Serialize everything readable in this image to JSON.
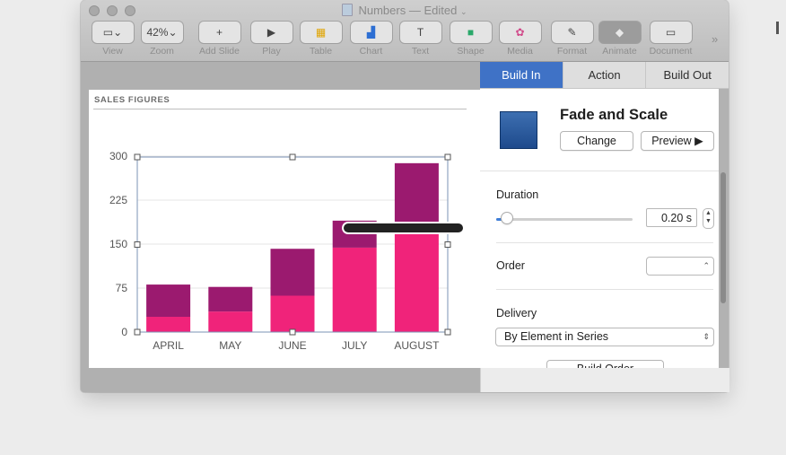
{
  "window": {
    "title": "Numbers",
    "status": "— Edited"
  },
  "toolbar": [
    {
      "label": "View",
      "icon": "sidebar-icon",
      "glyph": "▭⌄"
    },
    {
      "label": "Zoom",
      "icon": "zoom-icon",
      "glyph": "42%⌄"
    },
    {
      "label": "Add Slide",
      "icon": "plus-icon",
      "glyph": "+"
    },
    {
      "label": "Play",
      "icon": "play-icon",
      "glyph": "▶"
    },
    {
      "label": "Table",
      "icon": "table-icon",
      "glyph": "▦"
    },
    {
      "label": "Chart",
      "icon": "chart-icon",
      "glyph": "▟"
    },
    {
      "label": "Text",
      "icon": "text-icon",
      "glyph": "T"
    },
    {
      "label": "Shape",
      "icon": "shape-icon",
      "glyph": "■"
    },
    {
      "label": "Media",
      "icon": "media-icon",
      "glyph": "✿"
    },
    {
      "label": "Format",
      "icon": "format-icon",
      "glyph": "✎"
    },
    {
      "label": "Animate",
      "icon": "animate-icon",
      "glyph": "◆"
    },
    {
      "label": "Document",
      "icon": "document-icon",
      "glyph": "▭"
    }
  ],
  "toolbar_more": "»",
  "slide": {
    "chart_title": "SALES FIGURES"
  },
  "chart_data": {
    "type": "bar",
    "stacked": true,
    "title": "SALES FIGURES",
    "categories": [
      "APRIL",
      "MAY",
      "JUNE",
      "JULY",
      "AUGUST"
    ],
    "series": [
      {
        "values": [
          26,
          35,
          62,
          144,
          168
        ],
        "color": "#f0237a"
      },
      {
        "values": [
          55,
          42,
          80,
          46,
          120
        ],
        "color": "#9b1a6f"
      }
    ],
    "ylim": [
      0,
      300
    ],
    "yticks": [
      "0",
      "75",
      "150",
      "225",
      "300"
    ],
    "grid": true
  },
  "inspector": {
    "tabs": [
      {
        "label": "Build In",
        "selected": true
      },
      {
        "label": "Action",
        "selected": false
      },
      {
        "label": "Build Out",
        "selected": false
      }
    ],
    "effect_name": "Fade and Scale",
    "change_label": "Change",
    "preview_label": "Preview ▶",
    "duration_label": "Duration",
    "duration_value": "0.20 s",
    "duration_slider": 0.08,
    "order_label": "Order",
    "order_value": "",
    "delivery_label": "Delivery",
    "delivery_value": "By Element in Series",
    "build_order_label": "Build Order"
  },
  "colors": {
    "accent": "#3f72c6",
    "bar_light": "#f0237a",
    "bar_dark": "#9b1a6f"
  }
}
